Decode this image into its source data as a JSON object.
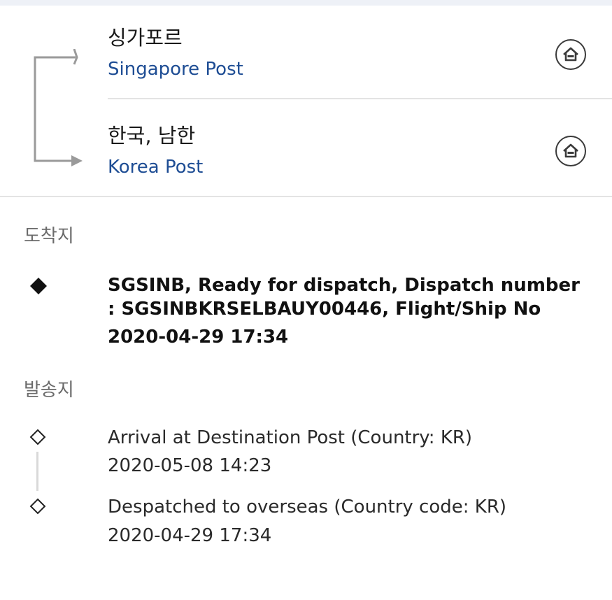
{
  "route": {
    "origin": {
      "country": "싱가포르",
      "carrier": "Singapore Post"
    },
    "destination": {
      "country": "한국, 남한",
      "carrier": "Korea Post"
    }
  },
  "destination_section": {
    "label": "도착지",
    "events": [
      {
        "description": "SGSINB, Ready for dispatch, Dispatch number : SGSINBKRSELBAUY00446, Flight/Ship No",
        "timestamp": "2020-04-29 17:34"
      }
    ]
  },
  "origin_section": {
    "label": "발송지",
    "events": [
      {
        "description": "Arrival at Destination Post (Country: KR)",
        "timestamp": "2020-05-08 14:23"
      },
      {
        "description": "Despatched to overseas (Country code: KR)",
        "timestamp": "2020-04-29 17:34"
      }
    ]
  },
  "colors": {
    "carrier_link": "#1e4d94",
    "divider": "#e3e3e3",
    "section_label": "#6b6b6b"
  }
}
